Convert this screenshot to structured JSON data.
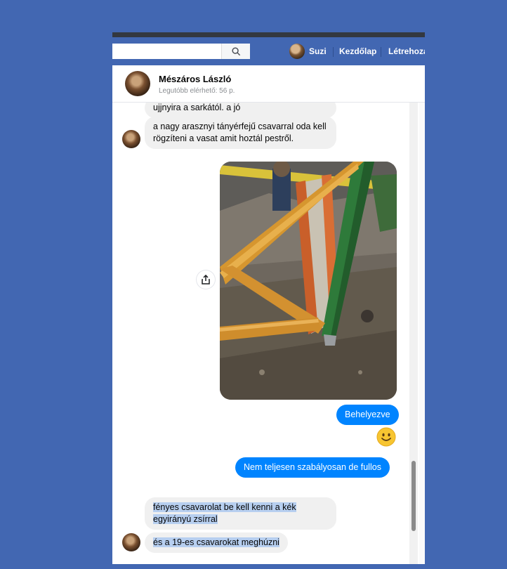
{
  "topbar": {
    "search_placeholder": "",
    "user_name": "Suzi",
    "home_label": "Kezdőlap",
    "create_label": "Létrehozá"
  },
  "conversation": {
    "name": "Mészáros László",
    "status": "Legutóbb elérhető: 56 p."
  },
  "messages": [
    {
      "direction": "in",
      "text": "ujjnyira a sarkától. a jó"
    },
    {
      "direction": "in",
      "text": "a nagy arasznyi tányérfejű csavarral oda kell rögzíteni a vasat amit hoztál pestről."
    },
    {
      "direction": "out",
      "type": "photo",
      "text": ""
    },
    {
      "direction": "out",
      "text": "Behelyezve"
    },
    {
      "direction": "out",
      "type": "emoji",
      "text": ""
    },
    {
      "direction": "out",
      "text": "Nem teljesen szabályosan de fullos"
    },
    {
      "direction": "in",
      "text": "fényes csavarolat be kell kenni a kék egyirányú zsírral"
    },
    {
      "direction": "in",
      "text": "és a 19-es csavarokat meghúzni"
    }
  ],
  "colors": {
    "brand": "#4267b2",
    "outgoing_bubble": "#0084ff",
    "incoming_bubble": "#f0f0f0",
    "selection": "#b7cff0"
  },
  "icons": {
    "search": "search-icon",
    "share": "share-icon",
    "emoji": "smiley-emoji-icon"
  }
}
